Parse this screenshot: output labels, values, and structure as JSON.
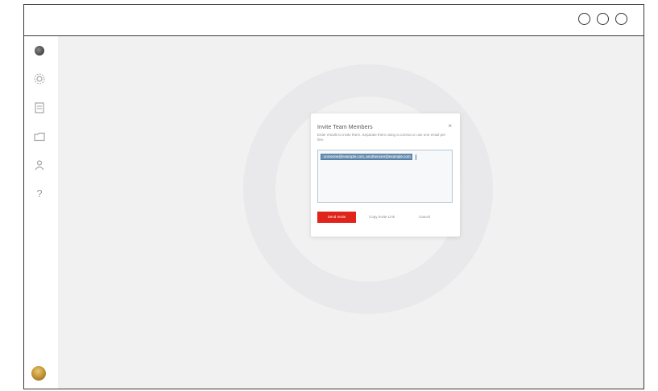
{
  "window": {
    "controls": [
      "circle-icon",
      "circle-icon",
      "circle-icon"
    ]
  },
  "sidebar": {
    "items": [
      {
        "name": "app-logo-icon"
      },
      {
        "name": "settings-icon"
      },
      {
        "name": "document-icon"
      },
      {
        "name": "folder-icon"
      },
      {
        "name": "user-icon"
      },
      {
        "name": "help-icon",
        "glyph": "?"
      }
    ],
    "avatar": "avatar"
  },
  "dialog": {
    "title": "Invite Team Members",
    "close": "×",
    "description": "Enter emails to invite them. Separate them using a comma or use one email per line.",
    "email_chip": "someone@example.com, anotheruser@example.com",
    "primary_button": "Send Invite",
    "secondary_button": "Copy Invite Link",
    "cancel_button": "Cancel"
  },
  "colors": {
    "primary": "#e0231b",
    "chip": "#6f93b4",
    "background": "#f1f1f1"
  }
}
